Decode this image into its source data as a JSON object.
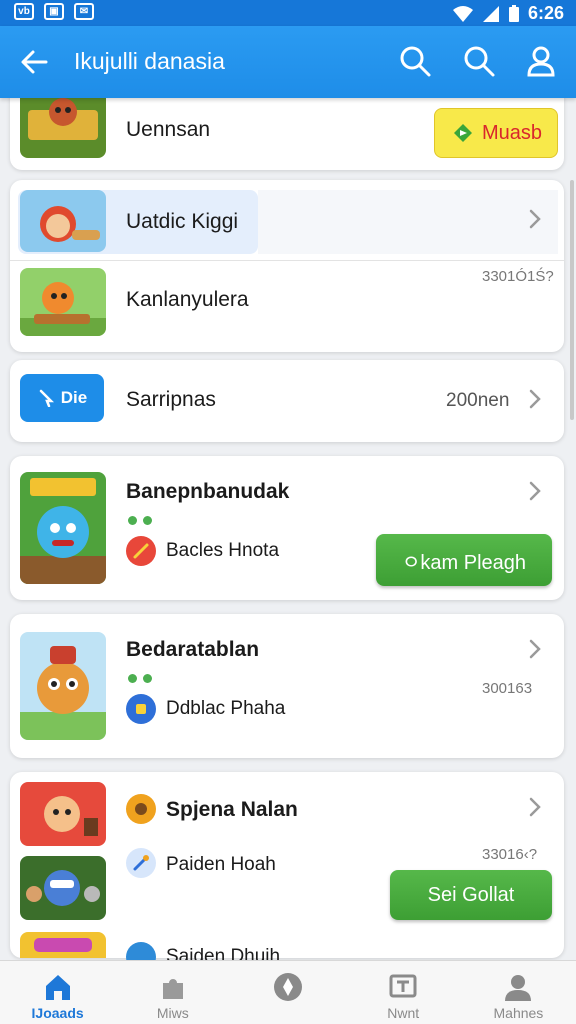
{
  "status_bar": {
    "icons": [
      "vb-icon",
      "image-icon",
      "mail-icon"
    ],
    "time": "6:26"
  },
  "app_bar": {
    "title": "Ikujulli danasia"
  },
  "cards": {
    "top": {
      "label": "Uennsan",
      "button": "Muasb"
    },
    "group1": {
      "row1": {
        "label": "Uatdic Kiggi"
      },
      "row2": {
        "label": "Kanlanyulera",
        "meta": "3301Ó1Ś?"
      }
    },
    "group2": {
      "tag": "Die",
      "label": "Sarripnas",
      "meta": "200nen"
    },
    "game1": {
      "title": "Banepnbanudak",
      "sub": "Bacles Hnota",
      "button": "ㅇkam Pleagh"
    },
    "game2": {
      "title": "Bedaratablan",
      "sub": "Ddblac Phaha",
      "meta": "300163"
    },
    "game3": {
      "title": "Spjena Nalan",
      "sub1": "Paiden Hoah",
      "meta": "33016‹?",
      "button": "Sei Gollat",
      "sub2": "Saiden Dhuih"
    }
  },
  "bottom_nav": [
    {
      "label": "IJoaads",
      "icon": "home-icon"
    },
    {
      "label": "Miws",
      "icon": "puzzle-icon"
    },
    {
      "label": "",
      "icon": "compass-icon"
    },
    {
      "label": "Nwnt",
      "icon": "news-icon"
    },
    {
      "label": "Mahnes",
      "icon": "profile-icon"
    }
  ],
  "colors": {
    "primary": "#1e8de8",
    "status_bar": "#1677d8",
    "green": "#4caf50",
    "yellow": "#f8e94a",
    "tag_blue": "#1e8de8"
  }
}
